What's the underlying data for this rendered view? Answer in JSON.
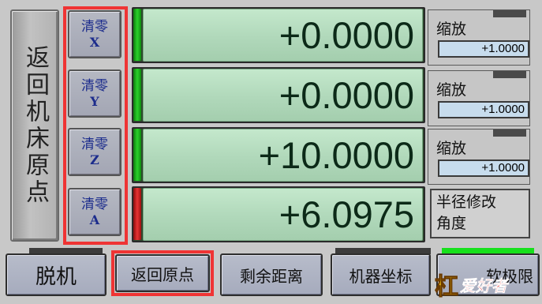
{
  "home_button": {
    "label": "返回机床原点"
  },
  "zero_buttons": [
    {
      "label": "清零",
      "axis": "X"
    },
    {
      "label": "清零",
      "axis": "Y"
    },
    {
      "label": "清零",
      "axis": "Z"
    },
    {
      "label": "清零",
      "axis": "A"
    }
  ],
  "dro": [
    {
      "axis": "X",
      "value": "+0.0000",
      "led": "green"
    },
    {
      "axis": "Y",
      "value": "+0.0000",
      "led": "green"
    },
    {
      "axis": "Z",
      "value": "+10.0000",
      "led": "green"
    },
    {
      "axis": "A",
      "value": "+6.0975",
      "led": "red"
    }
  ],
  "scales": [
    {
      "label": "缩放",
      "value": "+1.0000"
    },
    {
      "label": "缩放",
      "value": "+1.0000"
    },
    {
      "label": "缩放",
      "value": "+1.0000"
    }
  ],
  "radius_panel": {
    "line1": "半径修改",
    "line2": "角度"
  },
  "bottom_buttons": {
    "offline": "脱机",
    "home": "返回原点",
    "remaining": "剩余距离",
    "machine_coords": "机器坐标",
    "soft_limit": "软极限"
  },
  "logo": {
    "main": "杠",
    "sub": "爱好者"
  },
  "colors": {
    "highlight_red": "#ef3434",
    "led_green": "#2ad22a",
    "led_red": "#e83434",
    "dro_bg": "#b8dcc0",
    "dro_text": "#0c2a18",
    "axis_letter": "#1c2c8c",
    "indicator_green": "#17e01c"
  }
}
